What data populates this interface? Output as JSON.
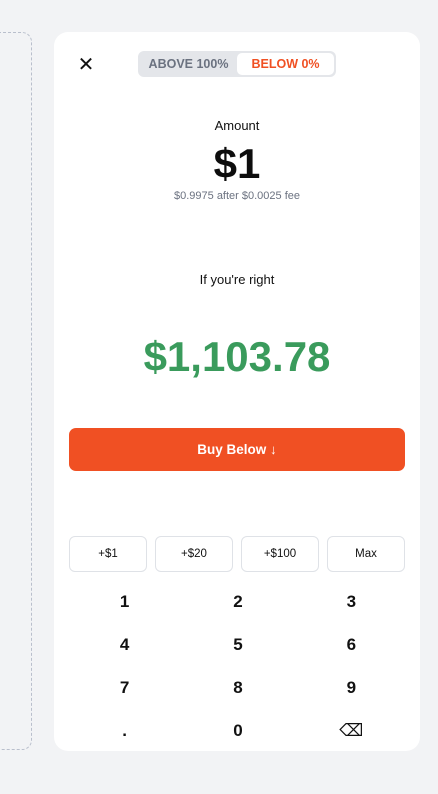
{
  "toggle": {
    "above_label": "ABOVE 100%",
    "below_label": "BELOW 0%",
    "selected": "below"
  },
  "amount": {
    "label": "Amount",
    "value": "$1",
    "fee_note": "$0.9975 after $0.0025 fee"
  },
  "payout": {
    "label": "If you're right",
    "value": "$1,103.78"
  },
  "buy_button": {
    "label": "Buy Below ↓"
  },
  "quick_amounts": [
    "+$1",
    "+$20",
    "+$100",
    "Max"
  ],
  "keypad": [
    "1",
    "2",
    "3",
    "4",
    "5",
    "6",
    "7",
    "8",
    "9",
    ".",
    "0",
    "⌫"
  ],
  "icons": {
    "close": "close-icon",
    "backspace": "backspace-icon"
  },
  "colors": {
    "accent": "#f05023",
    "payout_green": "#3a9b5c",
    "background": "#f2f3f5",
    "card": "#ffffff"
  }
}
